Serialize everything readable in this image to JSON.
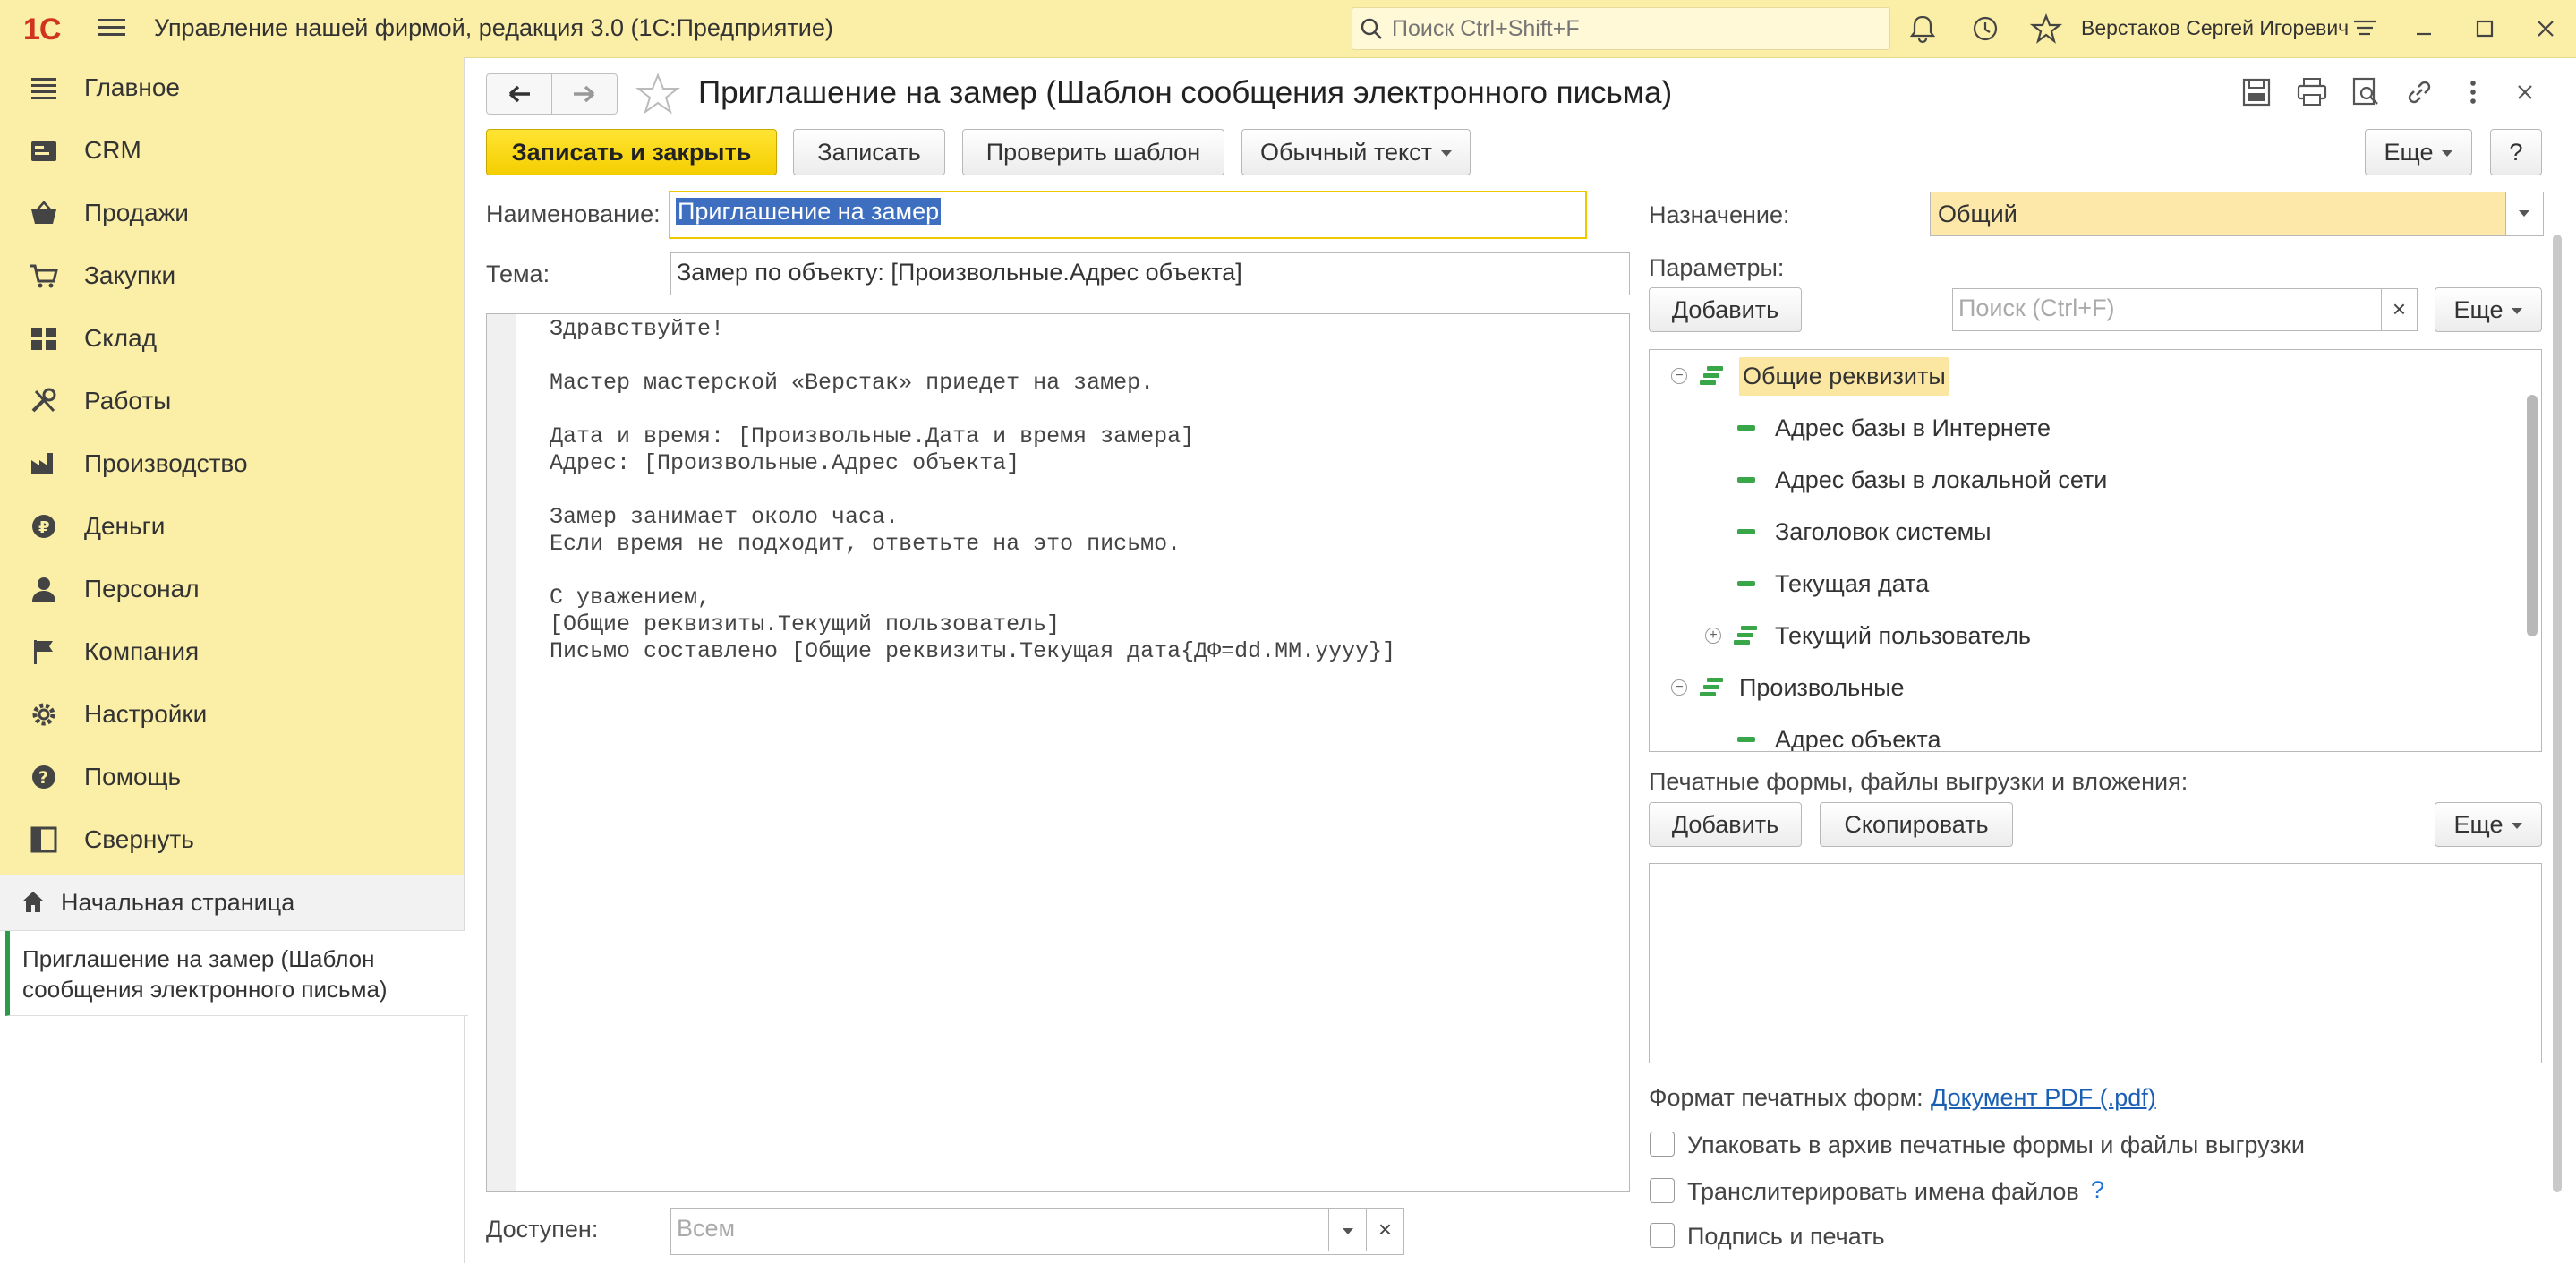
{
  "app": {
    "title": "Управление нашей фирмой, редакция 3.0  (1С:Предприятие)",
    "logo_text": "1С",
    "search_placeholder": "Поиск Ctrl+Shift+F",
    "user": "Верстаков Сергей Игоревич"
  },
  "sidebar": {
    "items": [
      {
        "label": "Главное",
        "icon": "list-icon"
      },
      {
        "label": "CRM",
        "icon": "crm-icon"
      },
      {
        "label": "Продажи",
        "icon": "basket-icon"
      },
      {
        "label": "Закупки",
        "icon": "cart-icon"
      },
      {
        "label": "Склад",
        "icon": "warehouse-icon"
      },
      {
        "label": "Работы",
        "icon": "tools-icon"
      },
      {
        "label": "Производство",
        "icon": "factory-icon"
      },
      {
        "label": "Деньги",
        "icon": "ruble-icon"
      },
      {
        "label": "Персонал",
        "icon": "person-icon"
      },
      {
        "label": "Компания",
        "icon": "flag-icon"
      },
      {
        "label": "Настройки",
        "icon": "gear-icon"
      },
      {
        "label": "Помощь",
        "icon": "help-icon"
      },
      {
        "label": "Свернуть",
        "icon": "collapse-icon"
      }
    ],
    "home": "Начальная страница",
    "open_window": "Приглашение на замер (Шаблон сообщения электронного письма)"
  },
  "form": {
    "title": "Приглашение на замер (Шаблон сообщения электронного письма)",
    "buttons": {
      "save_close": "Записать и закрыть",
      "save": "Записать",
      "check": "Проверить шаблон",
      "format": "Обычный текст",
      "more": "Еще",
      "help": "?"
    },
    "name_label": "Наименование:",
    "name_value": "Приглашение на замер",
    "subject_label": "Тема:",
    "subject_value": "Замер по объекту: [Произвольные.Адрес объекта]",
    "body_lines": [
      "Здравствуйте!",
      "",
      "Мастер мастерской «Верстак» приедет на замер.",
      "",
      "Дата и время: [Произвольные.Дата и время замера]",
      "Адрес: [Произвольные.Адрес объекта]",
      "",
      "Замер занимает около часа.",
      "Если время не подходит, ответьте на это письмо.",
      "",
      "С уважением,",
      "[Общие реквизиты.Текущий пользователь]",
      "Письмо составлено [Общие реквизиты.Текущая дата{ДФ=dd.MM.yyyy}]"
    ],
    "available_label": "Доступен:",
    "available_placeholder": "Всем"
  },
  "right": {
    "purpose_label": "Назначение:",
    "purpose_value": "Общий",
    "params_label": "Параметры:",
    "add": "Добавить",
    "search_placeholder": "Поиск (Ctrl+F)",
    "more": "Еще",
    "tree": [
      {
        "label": "Общие реквизиты",
        "level": 0,
        "group": true,
        "expanded": true,
        "selected": true
      },
      {
        "label": "Адрес базы в Интернете",
        "level": 1,
        "group": false
      },
      {
        "label": "Адрес базы в локальной сети",
        "level": 1,
        "group": false
      },
      {
        "label": "Заголовок системы",
        "level": 1,
        "group": false
      },
      {
        "label": "Текущая дата",
        "level": 1,
        "group": false
      },
      {
        "label": "Текущий пользователь",
        "level": 1,
        "group": true,
        "expanded": false
      },
      {
        "label": "Произвольные",
        "level": 0,
        "group": true,
        "expanded": true
      },
      {
        "label": "Адрес объекта",
        "level": 1,
        "group": false
      }
    ],
    "attachments_label": "Печатные формы, файлы выгрузки и вложения:",
    "attach_add": "Добавить",
    "attach_copy": "Скопировать",
    "attach_more": "Еще",
    "print_format_label": "Формат печатных форм:",
    "print_format_value": "Документ PDF (.pdf)",
    "checkboxes": [
      {
        "label": "Упаковать в архив печатные формы и файлы выгрузки",
        "checked": false
      },
      {
        "label": "Транслитерировать имена файлов",
        "checked": false,
        "help": "?"
      },
      {
        "label": "Подпись и печать",
        "checked": false
      }
    ]
  },
  "colors": {
    "accent": "#fbeea6",
    "primary_button": "#f4ce00",
    "tree_icon": "#3aa64a",
    "link": "#1a5fb4",
    "selection": "#3d6ec0"
  }
}
